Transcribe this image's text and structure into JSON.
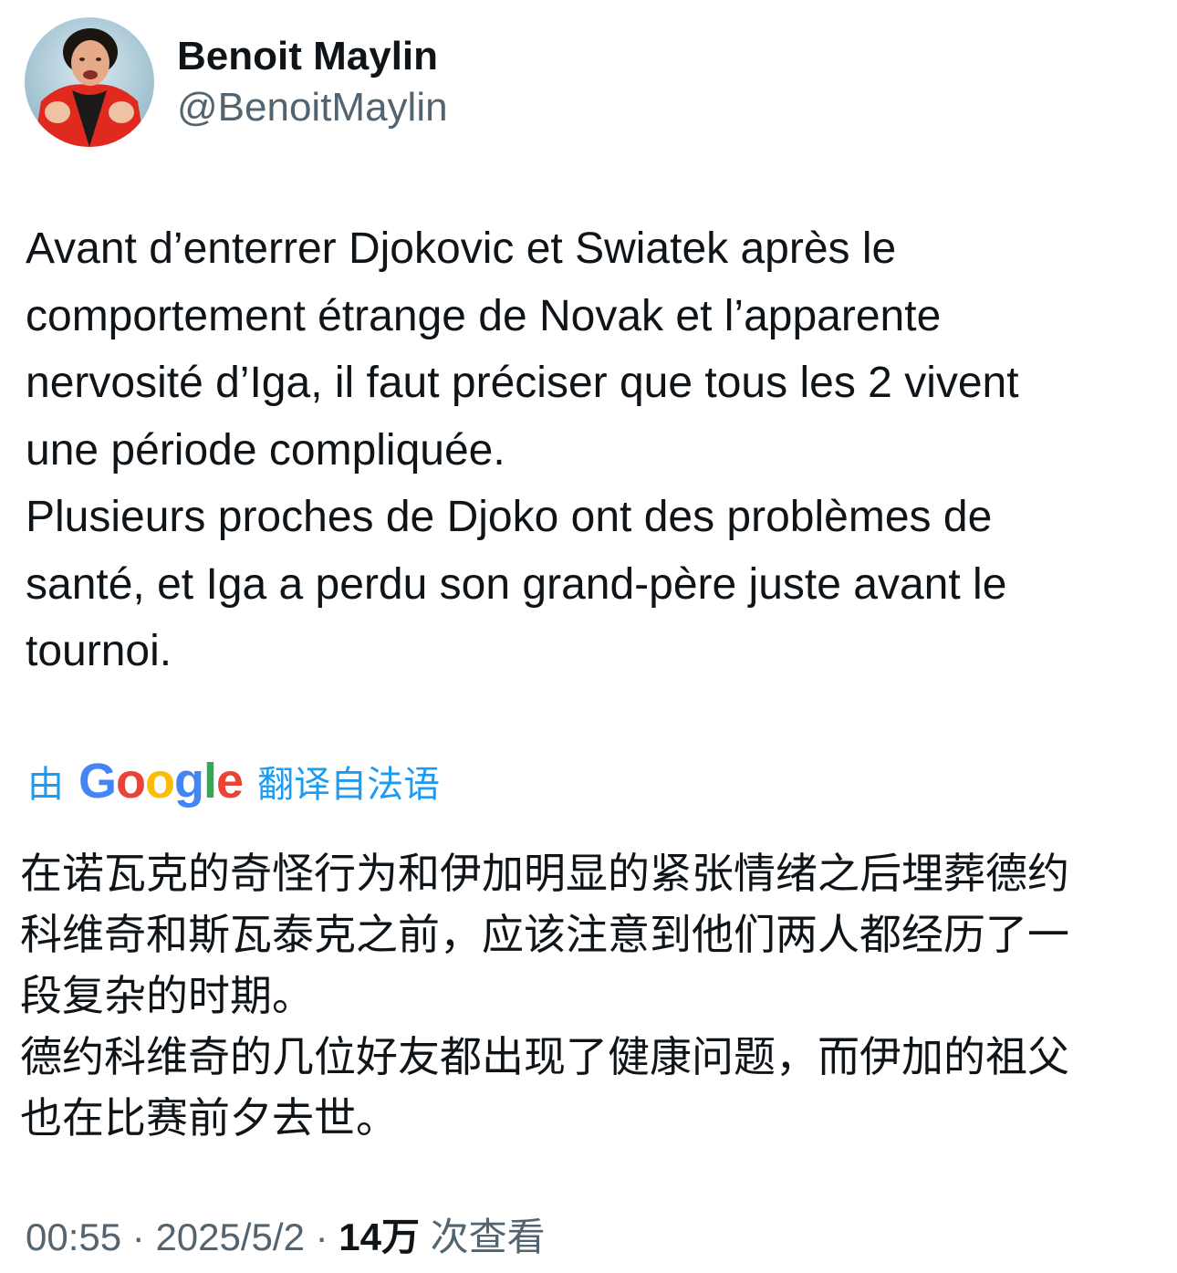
{
  "author": {
    "display_name": "Benoit Maylin",
    "handle": "@BenoitMaylin"
  },
  "tweet": {
    "text": "Avant d’enterrer Djokovic et Swiatek après le\ncomportement étrange de Novak et l’apparente\nnervosité d’Iga, il faut préciser que tous les 2 vivent\nune période compliquée.\nPlusieurs proches de Djoko ont des problèmes de\nsanté, et Iga a perdu son grand-père juste avant le\ntournoi."
  },
  "translation": {
    "prefix": "由",
    "provider": "Google",
    "suffix": "翻译自法语",
    "text": "在诺瓦克的奇怪行为和伊加明显的紧张情绪之后埋葬德约\n科维奇和斯瓦泰克之前，应该注意到他们两人都经历了一\n段复杂的时期。\n德约科维奇的几位好友都出现了健康问题，而伊加的祖父\n也在比赛前夕去世。"
  },
  "meta": {
    "time": "00:55",
    "separator": " · ",
    "date": "2025/5/2",
    "views_count": "14万",
    "views_label": "次查看"
  },
  "colors": {
    "link": "#1d9bf0",
    "secondary_text": "#536471",
    "primary_text": "#0f1419",
    "avatar_shirt": "#e02a20"
  }
}
